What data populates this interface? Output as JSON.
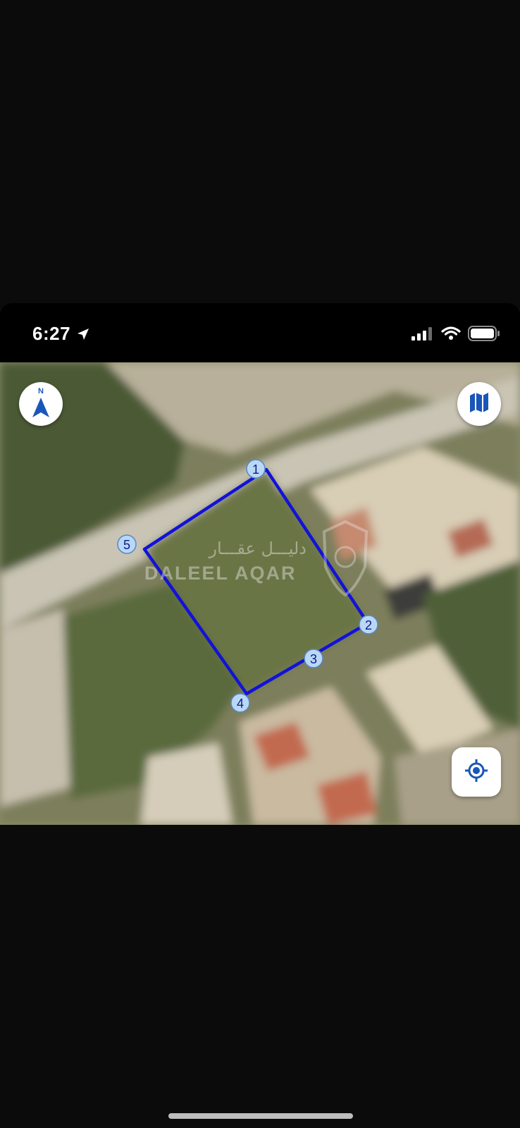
{
  "status_bar": {
    "time": "6:27"
  },
  "map": {
    "polygon_color": "#1212d8",
    "vertex_fill": "#b9d8f5",
    "vertices": [
      {
        "label": "1"
      },
      {
        "label": "2"
      },
      {
        "label": "3"
      },
      {
        "label": "4"
      },
      {
        "label": "5"
      }
    ],
    "compass_label": "N",
    "watermark": {
      "arabic": "دليـــل عقـــار",
      "latin": "DALEEL AQAR"
    }
  },
  "icons": {
    "location_arrow": "location-arrow-icon",
    "signal": "cellular-signal-icon",
    "wifi": "wifi-icon",
    "battery": "battery-icon",
    "compass": "compass-north-icon",
    "layers": "map-layers-icon",
    "locate": "locate-me-icon"
  }
}
